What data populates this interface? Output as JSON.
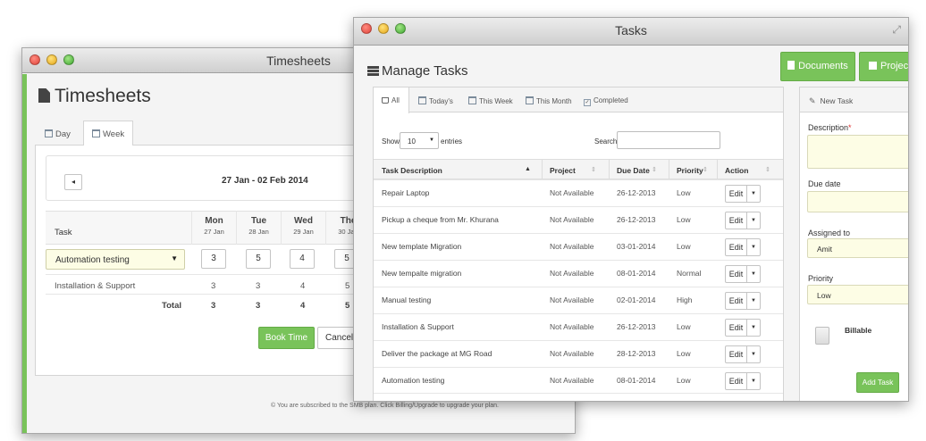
{
  "timesheets": {
    "window_title": "Timesheets",
    "heading": "Timesheets",
    "tabs": [
      {
        "label": "Day"
      },
      {
        "label": "Week"
      }
    ],
    "date_range": "27 Jan - 02 Feb 2014",
    "task_header": "Task",
    "days": [
      {
        "day": "Mon",
        "date": "27 Jan"
      },
      {
        "day": "Tue",
        "date": "28 Jan"
      },
      {
        "day": "Wed",
        "date": "29 Jan"
      },
      {
        "day": "The",
        "date": "30 Jan"
      }
    ],
    "task_select": "Automation testing",
    "inputs": [
      "3",
      "5",
      "4",
      "5"
    ],
    "rows": [
      {
        "task": "Installation & Support",
        "values": [
          "3",
          "3",
          "4",
          "5"
        ]
      }
    ],
    "total_label": "Total",
    "totals": [
      "3",
      "3",
      "4",
      "5"
    ],
    "book_time": "Book Time",
    "cancel": "Cancel",
    "footer": "© You are subscribed to the SMB plan. Click Billing/Upgrade to upgrade your plan."
  },
  "tasks": {
    "window_title": "Tasks",
    "heading": "Manage Tasks",
    "documents_button": "Documents",
    "projects_button": "Projec",
    "tabs": [
      {
        "label": "All"
      },
      {
        "label": "Today's"
      },
      {
        "label": "This Week"
      },
      {
        "label": "This Month"
      },
      {
        "label": "Completed"
      }
    ],
    "show_label": "Show",
    "show_value": "10",
    "entries_label": "entries",
    "search_label": "Search:",
    "search_value": "",
    "columns": [
      "Task Description",
      "Project",
      "Due Date",
      "Priority",
      "Action"
    ],
    "rows": [
      {
        "desc": "Repair Laptop",
        "project": "Not Available",
        "due": "26-12-2013",
        "priority": "Low",
        "action": "Edit"
      },
      {
        "desc": "Pickup a cheque from Mr. Khurana",
        "project": "Not Available",
        "due": "26-12-2013",
        "priority": "Low",
        "action": "Edit"
      },
      {
        "desc": "New template Migration",
        "project": "Not Available",
        "due": "03-01-2014",
        "priority": "Low",
        "action": "Edit"
      },
      {
        "desc": "New tempalte migration",
        "project": "Not Available",
        "due": "08-01-2014",
        "priority": "Normal",
        "action": "Edit"
      },
      {
        "desc": "Manual testing",
        "project": "Not Available",
        "due": "02-01-2014",
        "priority": "High",
        "action": "Edit"
      },
      {
        "desc": "Installation & Support",
        "project": "Not Available",
        "due": "26-12-2013",
        "priority": "Low",
        "action": "Edit"
      },
      {
        "desc": "Deliver the package at MG Road",
        "project": "Not Available",
        "due": "28-12-2013",
        "priority": "Low",
        "action": "Edit"
      },
      {
        "desc": "Automation testing",
        "project": "Not Available",
        "due": "08-01-2014",
        "priority": "Low",
        "action": "Edit"
      }
    ],
    "new_task": {
      "header": "New Task",
      "description_label": "Description",
      "required_mark": "*",
      "due_date_label": "Due date",
      "assigned_label": "Assigned to",
      "assigned_value": "Amit",
      "priority_label": "Priority",
      "priority_value": "Low",
      "billable_label": "Billable",
      "add_button": "Add Task"
    }
  }
}
